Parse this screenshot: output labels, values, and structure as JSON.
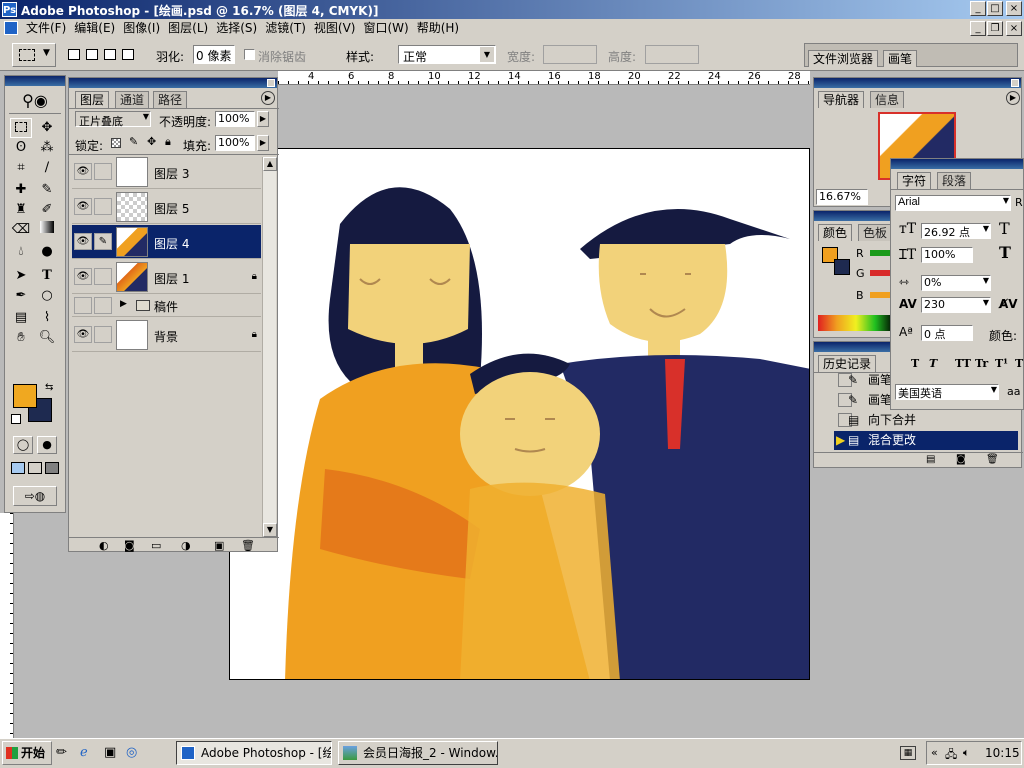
{
  "app": {
    "title": "Adobe Photoshop - [绘画.psd @ 16.7% (图层 4, CMYK)]"
  },
  "menu": [
    "文件(F)",
    "编辑(E)",
    "图像(I)",
    "图层(L)",
    "选择(S)",
    "滤镜(T)",
    "视图(V)",
    "窗口(W)",
    "帮助(H)"
  ],
  "options": {
    "feather_label": "羽化:",
    "feather_value": "0 像素",
    "antialias_label": "消除锯齿",
    "style_label": "样式:",
    "style_value": "正常",
    "width_label": "宽度:",
    "height_label": "高度:",
    "well_tabs": [
      "文件浏览器",
      "画笔"
    ]
  },
  "ruler": {
    "ticks": [
      "4",
      "6",
      "8",
      "10",
      "12",
      "14",
      "16",
      "18",
      "20",
      "22",
      "24",
      "26",
      "28"
    ]
  },
  "layers_panel": {
    "tabs": [
      "图层",
      "通道",
      "路径"
    ],
    "blend_mode": "正片叠底",
    "opacity_label": "不透明度:",
    "opacity_value": "100%",
    "lock_label": "锁定:",
    "fill_label": "填充:",
    "fill_value": "100%",
    "layers": [
      {
        "name": "图层 3",
        "visible": true,
        "selected": false,
        "locked": false
      },
      {
        "name": "图层 5",
        "visible": true,
        "selected": false,
        "locked": false
      },
      {
        "name": "图层 4",
        "visible": true,
        "selected": true,
        "locked": false
      },
      {
        "name": "图层 1",
        "visible": true,
        "selected": false,
        "locked": true
      },
      {
        "name": "稿件",
        "visible": false,
        "selected": false,
        "locked": false,
        "is_group": true
      },
      {
        "name": "背景",
        "visible": true,
        "selected": false,
        "locked": true
      }
    ]
  },
  "navigator_panel": {
    "tabs": [
      "导航器",
      "信息"
    ],
    "zoom": "16.67%"
  },
  "color_panel": {
    "tabs": [
      "颜色",
      "色板"
    ],
    "channels": [
      "R",
      "G",
      "B"
    ]
  },
  "character_panel": {
    "tabs": [
      "字符",
      "段落"
    ],
    "font": "Arial",
    "font_style_initial": "R",
    "size": "26.92 点",
    "vscale": "100%",
    "tracking_label": "0%",
    "kerning": "230",
    "baseline": "0 点",
    "color_label": "颜色:",
    "language": "美国英语",
    "style_buttons": [
      "T",
      "T",
      "TT",
      "Tr",
      "T¹",
      "T"
    ],
    "aa_label": "aa"
  },
  "history_panel": {
    "tabs": [
      "历史记录"
    ],
    "items": [
      {
        "label": "画笔",
        "selected": false
      },
      {
        "label": "画笔",
        "selected": false
      },
      {
        "label": "向下合并",
        "selected": false
      },
      {
        "label": "混合更改",
        "selected": true
      }
    ]
  },
  "colors": {
    "foreground": "#f0a820",
    "background": "#1e2a50",
    "accent": "#0a246a"
  },
  "taskbar": {
    "start": "开始",
    "tasks": [
      {
        "label": "Adobe Photoshop - [绘...",
        "active": true
      },
      {
        "label": "会员日海报_2 - Window...",
        "active": false
      }
    ],
    "clock": "10:15"
  }
}
